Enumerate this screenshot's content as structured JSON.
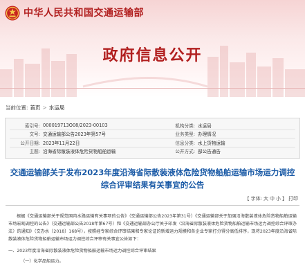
{
  "header": {
    "ministry_name": "中华人民共和国交通运输部",
    "section_title": "政府信息公开"
  },
  "breadcrumb": {
    "prefix": "当前位置:",
    "items": [
      "首页",
      "水运局"
    ],
    "separator": ">"
  },
  "meta": {
    "rows": [
      {
        "k1": "索引号:",
        "v1": "000019713O08/2023-00103",
        "k2": "机构分类:",
        "v2": "水运局"
      },
      {
        "k1": "文号:",
        "v1": "交通运输部公告2023年第57号",
        "k2": "业务类型:",
        "v2": "办理情况"
      },
      {
        "k1": "公开日期:",
        "v1": "2023年11月22日",
        "k2": "信息分类:",
        "v2": "水上货物运输"
      },
      {
        "k1": "主题:",
        "v1": "沿海省际散装液体危险货物船舶运输",
        "k2": "公开方式:",
        "v2": "部公告通告"
      }
    ]
  },
  "article": {
    "title": "交通运输部关于发布2023年度沿海省际散装液体危险货物船舶运输市场运力调控综合评审结果有关事宜的公告",
    "font_size_label": "【 字体:",
    "font_sizes": [
      "大",
      "中",
      "小"
    ],
    "font_size_end": "】",
    "print_label": "打印",
    "paragraph_1": "根据《交通运输部关于规范国内水路运输有关事项的公告》（交通运输部公告2023年第31号）《交通运输部关于加强沿海散装液体危险货物船舶运输市场宏观调控的公告》（交通运输部公告2018年第67号）和《交通运输部办公厅关于印发〈沿海省际散装液体危险货物船舶运输市场运力调控综合评审办法〉的通知》（交办水〔2018〕168号），按照经专家综合评审结果和专家论证的新增运力规模和各企业专家打分得分高低排序，现将2023年度沿海省际散装液体危险货物船舶运输市场运力调控综合评审有关事宜公告如下：",
    "section_1": "一、2023年度沿海省际散装液体危险货物船舶运输市场运力调控综合评审结果",
    "subsection_1": "（一）化学品船运力。"
  }
}
